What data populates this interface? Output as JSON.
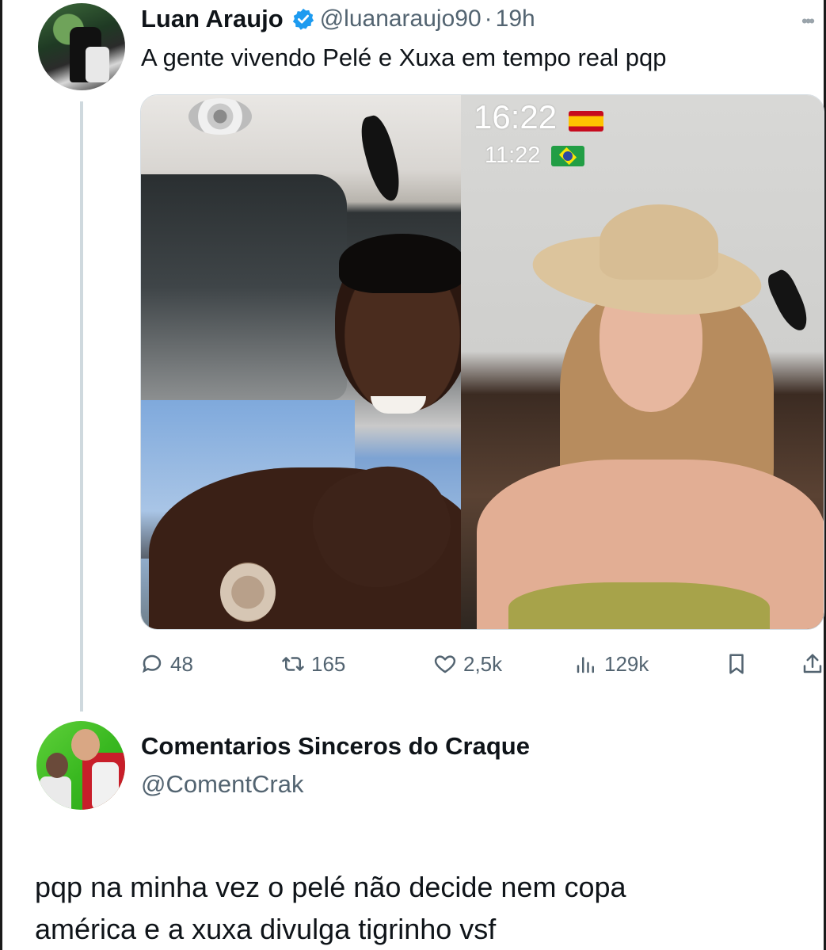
{
  "tweet1": {
    "author_name": "Luan Araujo",
    "handle": "@luanaraujo90",
    "separator": "·",
    "time": "19h",
    "text": "A gente vivendo Pelé e Xuxa em tempo real pqp",
    "verified": true,
    "media": {
      "clock_spain": "16:22",
      "clock_brazil": "11:22",
      "flag_left_icon": "spain-flag-icon",
      "flag_right_icon": "brazil-flag-icon"
    },
    "actions": {
      "replies": "48",
      "retweets": "165",
      "likes": "2,5k",
      "views": "129k"
    }
  },
  "tweet2": {
    "author_name": "Comentarios Sinceros do Craque",
    "handle": "@ComentCrak",
    "text_line1": "pqp na minha vez o pelé não decide nem copa",
    "text_line2": "américa e a xuxa divulga tigrinho vsf"
  },
  "colors": {
    "text_primary": "#0f1419",
    "text_secondary": "#536471",
    "verified_blue": "#1d9bf0",
    "thread_line": "#cfd9de"
  }
}
